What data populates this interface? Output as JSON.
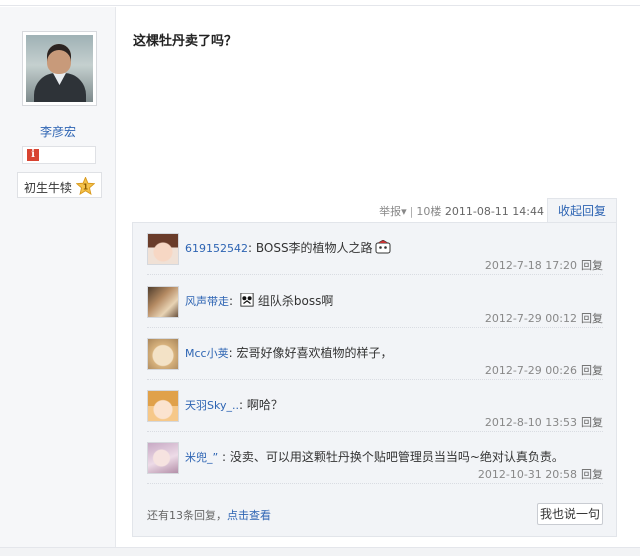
{
  "user": {
    "name": "李彦宏",
    "level_label": "初生牛犊",
    "level_number": "1"
  },
  "post": {
    "title": "这棵牡丹卖了吗？",
    "report_label": "举报",
    "floor": "10楼",
    "datetime": "2011-08-11 14:44",
    "collapse_label": "收起回复"
  },
  "replies": [
    {
      "name": "619152542",
      "text": "BOSS李的植物人之路",
      "time": "2012-7-18 17:20",
      "reply_label": "回复",
      "emoticon": "face-emoticon-icon"
    },
    {
      "name": "风声带走",
      "text": "组队杀boss啊",
      "time": "2012-7-29 00:12",
      "reply_label": "回复",
      "emoticon": "panda-emoticon-icon"
    },
    {
      "name": "Mcc小荚",
      "text": "宏哥好像好喜欢植物的样子，",
      "time": "2012-7-29 00:26",
      "reply_label": "回复",
      "emoticon": ""
    },
    {
      "name": "天羽Sky_..",
      "text": "啊哈？",
      "time": "2012-8-10 13:53",
      "reply_label": "回复",
      "emoticon": ""
    },
    {
      "name": "米兜_”",
      "text": "没卖、可以用这颗牡丹换个贴吧管理员当当吗~绝对认真负责。",
      "time": "2012-10-31 20:58",
      "reply_label": "回复",
      "emoticon": ""
    }
  ],
  "footer": {
    "more_prefix": "还有13条回复，",
    "more_link": "点击查看",
    "say_button": "我也说一句"
  },
  "colors": {
    "link": "#2d64b3",
    "panel_bg": "#f2f4f7"
  }
}
